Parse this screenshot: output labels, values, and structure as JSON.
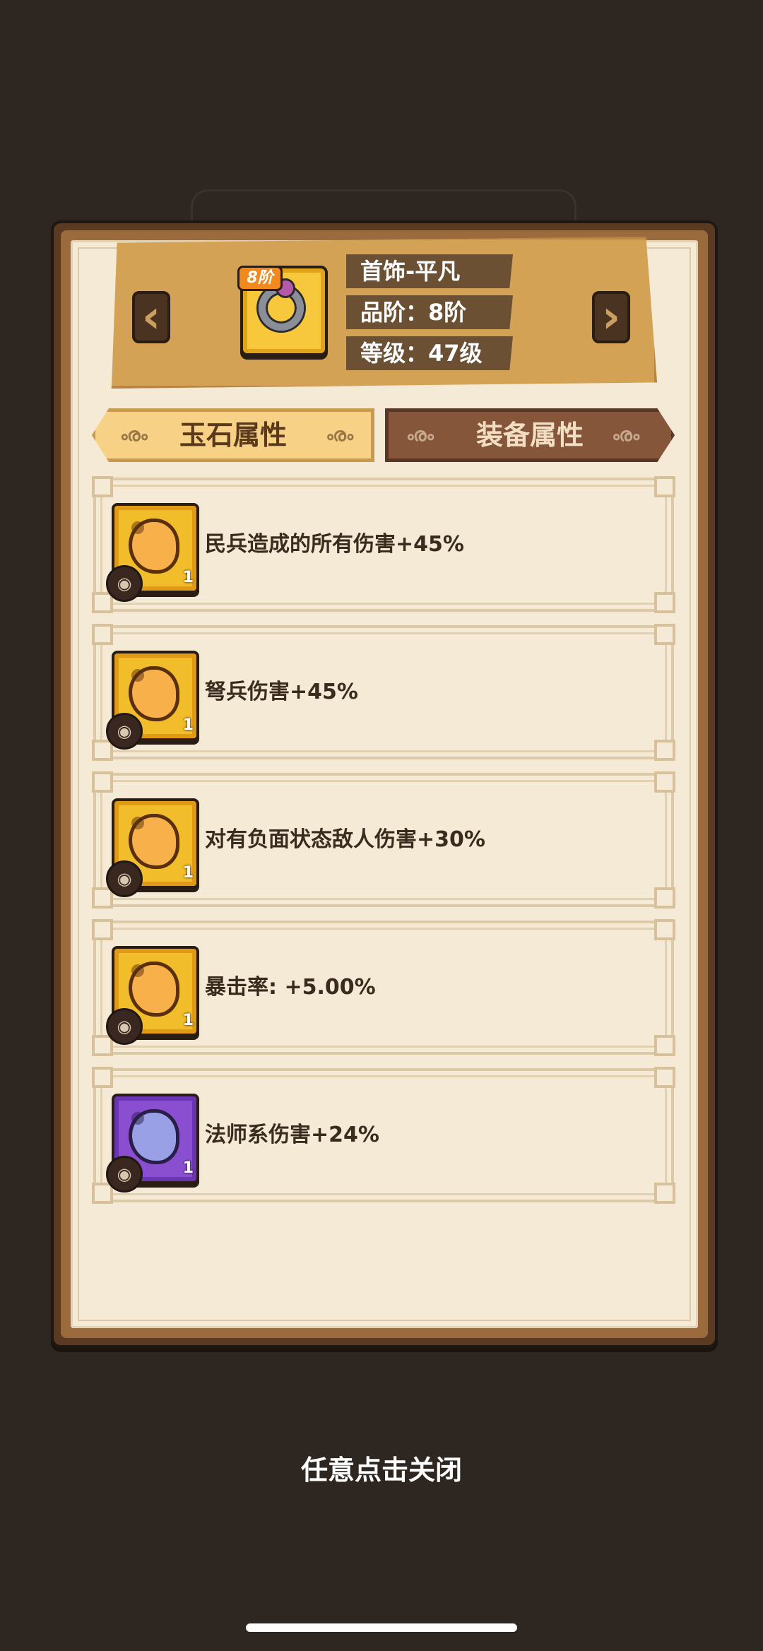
{
  "item": {
    "name": "首饰-平凡",
    "tier_badge": "8阶",
    "quality": "品阶：8阶",
    "level": "等级：47级",
    "icon": "ring-icon"
  },
  "tabs": [
    {
      "label": "玉石属性",
      "active": true
    },
    {
      "label": "装备属性",
      "active": false
    }
  ],
  "attributes": [
    {
      "text": "民兵造成的所有伤害+45%",
      "jade_color": "gold",
      "count": "1"
    },
    {
      "text": "弩兵伤害+45%",
      "jade_color": "gold",
      "count": "1"
    },
    {
      "text": "对有负面状态敌人伤害+30%",
      "jade_color": "gold",
      "count": "1"
    },
    {
      "text": "暴击率: +5.00%",
      "jade_color": "gold",
      "count": "1"
    },
    {
      "text": "法师系伤害+24%",
      "jade_color": "purple",
      "count": "1"
    }
  ],
  "close_hint": "任意点击关闭",
  "colors": {
    "background": "#2e2621",
    "paper": "#f4ead6",
    "frame": "#5a3a22",
    "header_plate": "#d4a255",
    "tab_active": "#f7d186",
    "tab_inactive": "#86563b"
  }
}
